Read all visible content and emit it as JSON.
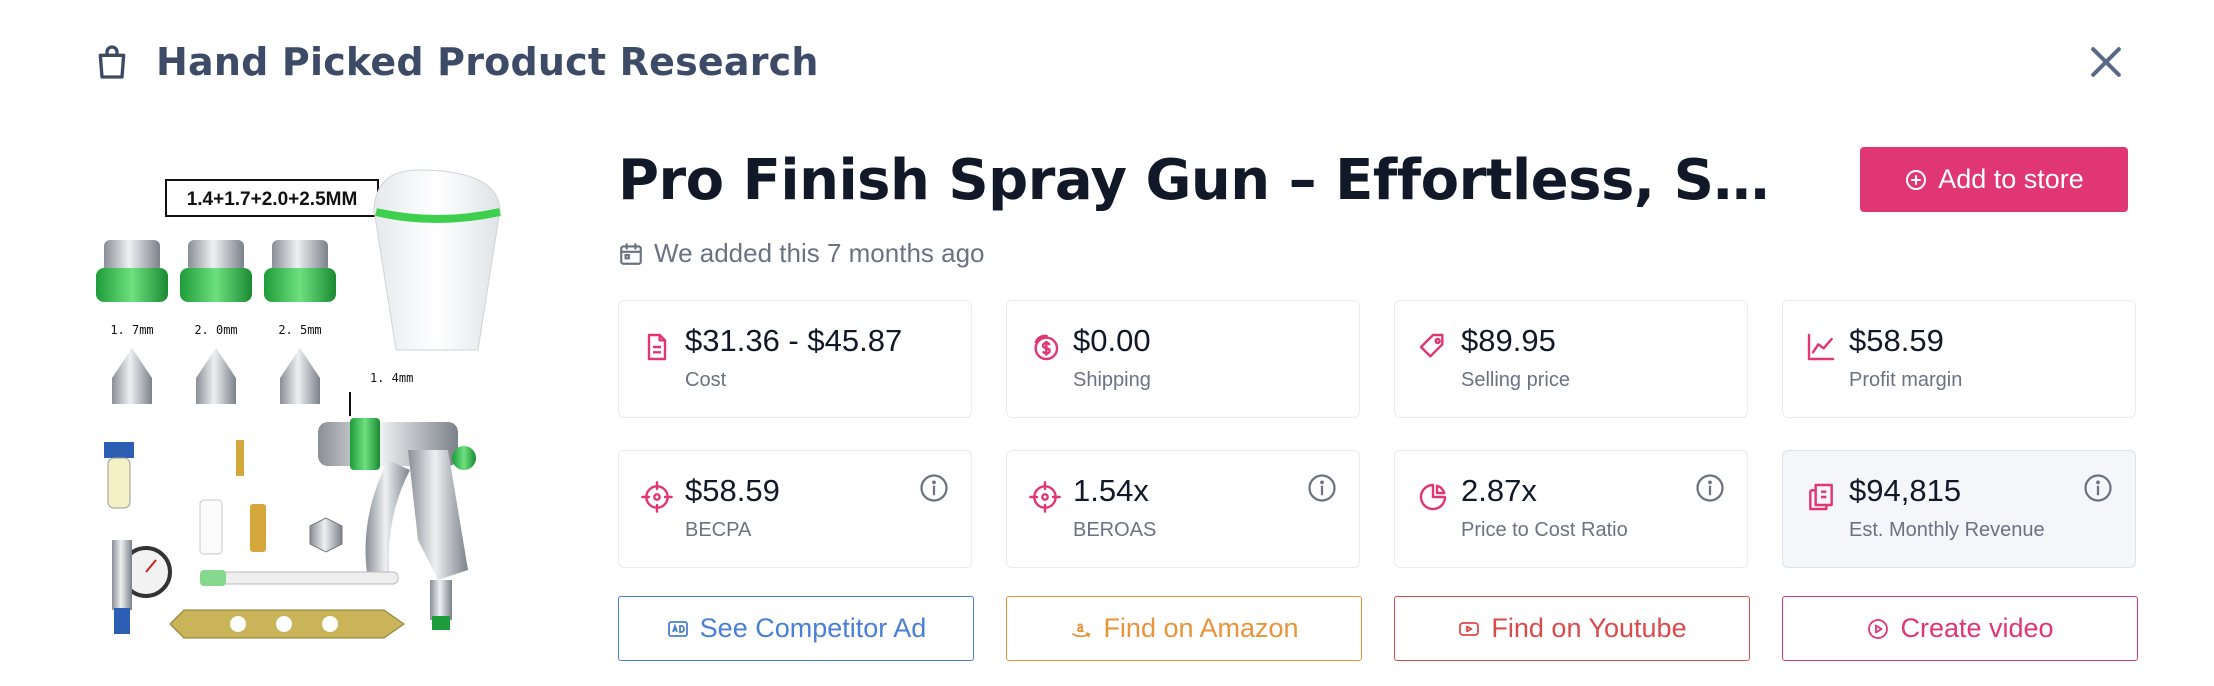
{
  "header": {
    "title": "Hand Picked Product Research",
    "icon": "shopping-bag-icon"
  },
  "product": {
    "title": "Pro Finish Spray Gun – Effortless, Smo...",
    "added_text": "We added this 7 months ago",
    "image_label": "1.4+1.7+2.0+2.5MM",
    "nozzle_labels": [
      "1. 7mm",
      "2. 0mm",
      "2. 5mm"
    ],
    "gun_nozzle_label": "1. 4mm"
  },
  "actions": {
    "add_to_store": "Add to store"
  },
  "metrics": [
    {
      "value": "$31.36 - $45.87",
      "label": "Cost",
      "icon": "document-icon",
      "info": false
    },
    {
      "value": "$0.00",
      "label": "Shipping",
      "icon": "coins-icon",
      "info": false
    },
    {
      "value": "$89.95",
      "label": "Selling price",
      "icon": "price-tag-icon",
      "info": false
    },
    {
      "value": "$58.59",
      "label": "Profit margin",
      "icon": "line-chart-icon",
      "info": false
    },
    {
      "value": "$58.59",
      "label": "BECPA",
      "icon": "crosshair-icon",
      "info": true
    },
    {
      "value": "1.54x",
      "label": "BEROAS",
      "icon": "crosshair-icon",
      "info": true
    },
    {
      "value": "2.87x",
      "label": "Price to Cost Ratio",
      "icon": "pie-chart-icon",
      "info": true
    },
    {
      "value": "$94,815",
      "label": "Est. Monthly Revenue",
      "icon": "receipt-icon",
      "info": true
    }
  ],
  "buttons": {
    "competitor_ad": "See Competitor Ad",
    "amazon": "Find on Amazon",
    "youtube": "Find on Youtube",
    "create_video": "Create video"
  },
  "colors": {
    "accent": "#e03673",
    "heading": "#3d4b66",
    "competitor": "#4a7fd6",
    "amazon": "#e8943a",
    "youtube": "#db4b4b",
    "video": "#e03673"
  }
}
